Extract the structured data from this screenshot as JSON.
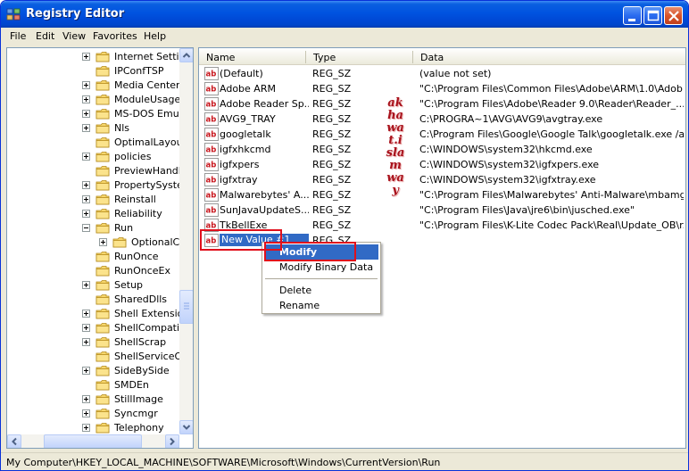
{
  "window": {
    "title": "Registry Editor"
  },
  "menu": [
    "File",
    "Edit",
    "View",
    "Favorites",
    "Help"
  ],
  "tree": {
    "items": [
      {
        "label": "Internet Settin",
        "expander": "plus",
        "selected": false
      },
      {
        "label": "IPConfTSP",
        "expander": "none",
        "selected": false
      },
      {
        "label": "Media Center",
        "expander": "plus",
        "selected": false
      },
      {
        "label": "ModuleUsage",
        "expander": "plus",
        "selected": false
      },
      {
        "label": "MS-DOS Emulat",
        "expander": "plus",
        "selected": false
      },
      {
        "label": "Nls",
        "expander": "plus",
        "selected": false
      },
      {
        "label": "OptimalLayout",
        "expander": "none",
        "selected": false
      },
      {
        "label": "policies",
        "expander": "plus",
        "selected": false
      },
      {
        "label": "PreviewHandle",
        "expander": "none",
        "selected": false
      },
      {
        "label": "PropertySyster",
        "expander": "plus",
        "selected": false
      },
      {
        "label": "Reinstall",
        "expander": "plus",
        "selected": false
      },
      {
        "label": "Reliability",
        "expander": "plus",
        "selected": false
      },
      {
        "label": "Run",
        "expander": "minus",
        "selected": false
      },
      {
        "label": "OptionalCo",
        "expander": "plus",
        "selected": false,
        "child": true
      },
      {
        "label": "RunOnce",
        "expander": "none",
        "selected": false
      },
      {
        "label": "RunOnceEx",
        "expander": "none",
        "selected": false
      },
      {
        "label": "Setup",
        "expander": "plus",
        "selected": false
      },
      {
        "label": "SharedDlls",
        "expander": "none",
        "selected": false
      },
      {
        "label": "Shell Extension",
        "expander": "plus",
        "selected": false
      },
      {
        "label": "ShellCompatibil",
        "expander": "plus",
        "selected": false
      },
      {
        "label": "ShellScrap",
        "expander": "plus",
        "selected": false
      },
      {
        "label": "ShellServiceOb",
        "expander": "none",
        "selected": false
      },
      {
        "label": "SideBySide",
        "expander": "plus",
        "selected": false
      },
      {
        "label": "SMDEn",
        "expander": "none",
        "selected": false
      },
      {
        "label": "StillImage",
        "expander": "plus",
        "selected": false
      },
      {
        "label": "Syncmgr",
        "expander": "plus",
        "selected": false
      },
      {
        "label": "Telephony",
        "expander": "plus",
        "selected": false
      }
    ]
  },
  "list": {
    "columns": [
      "Name",
      "Type",
      "Data"
    ],
    "rows": [
      {
        "name": "(Default)",
        "type": "REG_SZ",
        "data": "(value not set)"
      },
      {
        "name": "Adobe ARM",
        "type": "REG_SZ",
        "data": "\"C:\\Program Files\\Common Files\\Adobe\\ARM\\1.0\\Adob..."
      },
      {
        "name": "Adobe Reader Sp...",
        "type": "REG_SZ",
        "data": "\"C:\\Program Files\\Adobe\\Reader 9.0\\Reader\\Reader_..."
      },
      {
        "name": "AVG9_TRAY",
        "type": "REG_SZ",
        "data": "C:\\PROGRA~1\\AVG\\AVG9\\avgtray.exe"
      },
      {
        "name": "googletalk",
        "type": "REG_SZ",
        "data": "C:\\Program Files\\Google\\Google Talk\\googletalk.exe /a..."
      },
      {
        "name": "igfxhkcmd",
        "type": "REG_SZ",
        "data": "C:\\WINDOWS\\system32\\hkcmd.exe"
      },
      {
        "name": "igfxpers",
        "type": "REG_SZ",
        "data": "C:\\WINDOWS\\system32\\igfxpers.exe"
      },
      {
        "name": "igfxtray",
        "type": "REG_SZ",
        "data": "C:\\WINDOWS\\system32\\igfxtray.exe"
      },
      {
        "name": "Malwarebytes' A...",
        "type": "REG_SZ",
        "data": "\"C:\\Program Files\\Malwarebytes' Anti-Malware\\mbamg..."
      },
      {
        "name": "SunJavaUpdateS...",
        "type": "REG_SZ",
        "data": "\"C:\\Program Files\\Java\\jre6\\bin\\jusched.exe\""
      },
      {
        "name": "TkBellExe",
        "type": "REG_SZ",
        "data": "\"C:\\Program Files\\K-Lite Codec Pack\\Real\\Update_OB\\r..."
      },
      {
        "name": "New Value #1",
        "type": "REG_SZ",
        "data": ""
      }
    ]
  },
  "context_menu": {
    "items": [
      "Modify",
      "Modify Binary Data",
      "Delete",
      "Rename"
    ]
  },
  "watermark": "akhawat.islamway",
  "statusbar": {
    "path": "My Computer\\HKEY_LOCAL_MACHINE\\SOFTWARE\\Microsoft\\Windows\\CurrentVersion\\Run"
  },
  "colors": {
    "titlebar": "#0053e0",
    "selection": "#316ac5",
    "annotation": "#e0101c",
    "watermark": "#a8121c"
  }
}
